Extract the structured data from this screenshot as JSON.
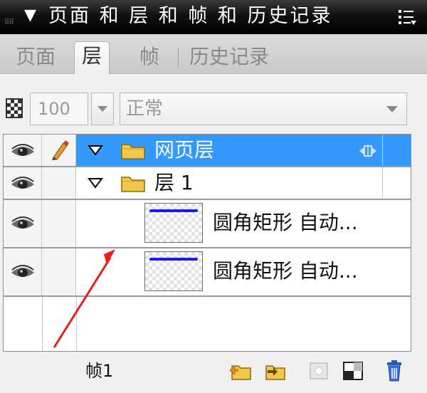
{
  "panel_title": "页面 和 层 和 帧 和 历史记录",
  "tabs": [
    {
      "label": "页面",
      "active": false
    },
    {
      "label": "层",
      "active": true
    },
    {
      "label": "帧",
      "active": false
    },
    {
      "label": "历史记录",
      "active": false
    }
  ],
  "controls": {
    "opacity_value": "100",
    "blend_mode": "正常"
  },
  "layers": [
    {
      "name": "网页层",
      "type": "folder",
      "expanded": true,
      "selected": true,
      "visible": true,
      "editable": true
    },
    {
      "name": "层 1",
      "type": "folder",
      "expanded": true,
      "selected": false,
      "visible": true,
      "editable": false
    },
    {
      "name": "圆角矩形 自动...",
      "type": "object",
      "visible": true
    },
    {
      "name": "圆角矩形 自动...",
      "type": "object",
      "visible": true
    }
  ],
  "footer": {
    "frame_label": "帧1"
  },
  "colors": {
    "selection": "#3399ff",
    "annotation_arrow": "#ee1c1c",
    "thumbnail_shape": "#1a1aee"
  },
  "icons": [
    "collapse-triangle-icon",
    "options-menu-icon",
    "opacity-checker-icon",
    "eye-icon",
    "pencil-icon",
    "folder-icon",
    "web-layer-icon",
    "new-layer-icon",
    "new-sublayer-icon",
    "effect-icon",
    "mask-icon",
    "trash-icon"
  ]
}
